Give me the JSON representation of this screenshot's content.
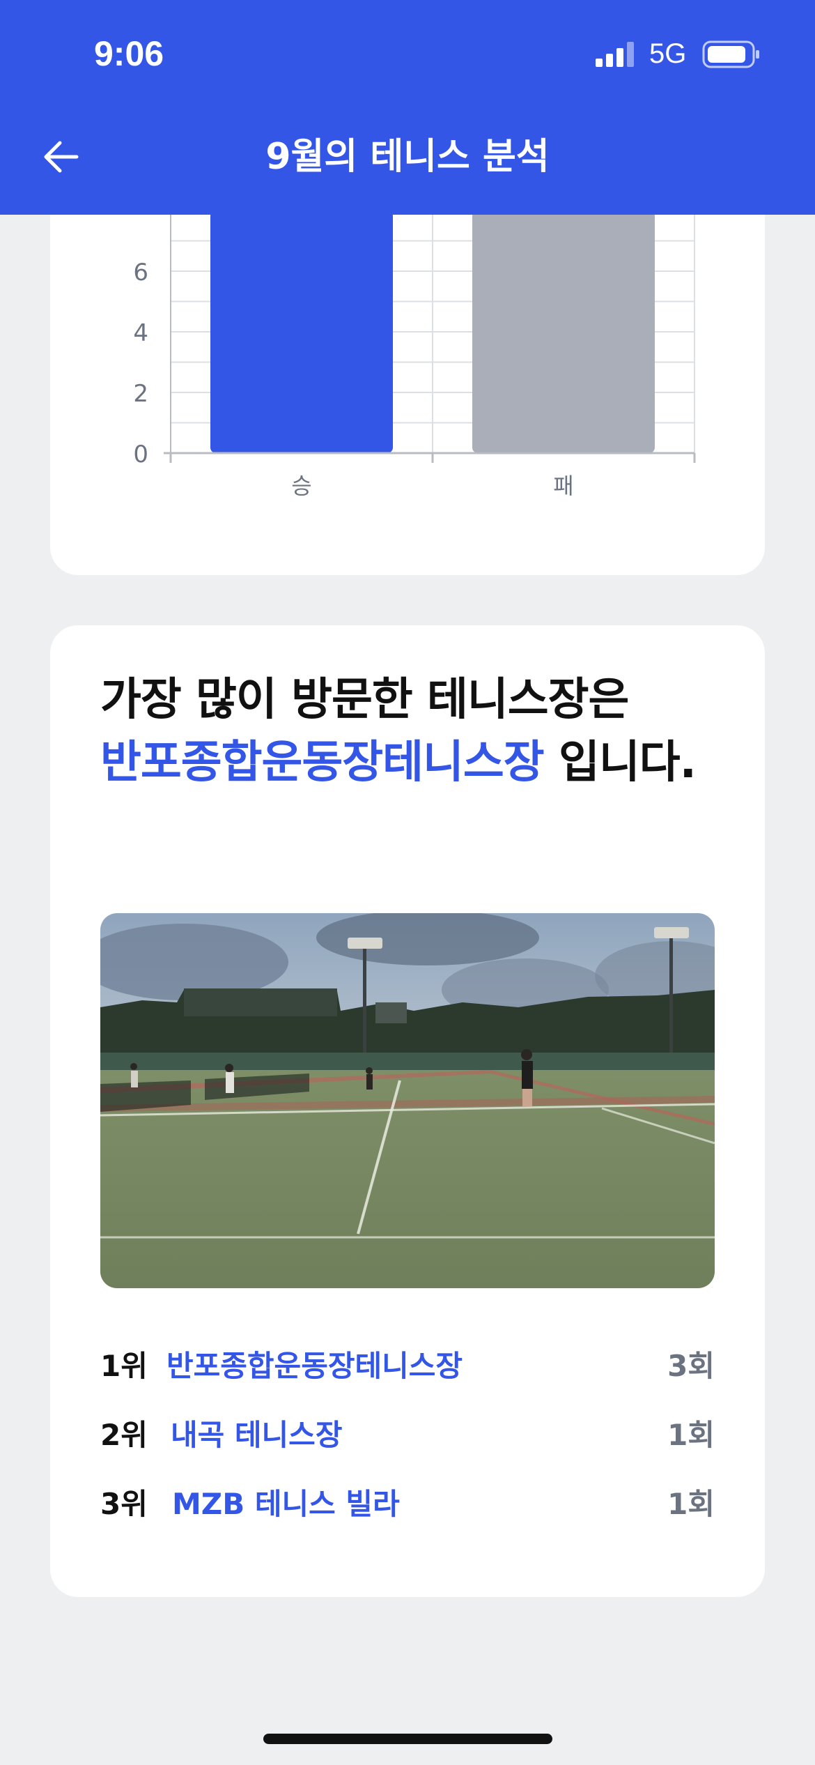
{
  "status_bar": {
    "time": "9:06",
    "network": "5G"
  },
  "header": {
    "title": "9월의 테니스 분석",
    "back_icon": "arrow-left-icon"
  },
  "colors": {
    "brand": "#3356e6",
    "win_bar": "#3356e6",
    "loss_bar": "#a9aeb8",
    "muted_text": "#6b7280"
  },
  "chart_data": {
    "type": "bar",
    "categories": [
      "승",
      "패"
    ],
    "series": [
      {
        "values": [
          8,
          8
        ]
      }
    ],
    "y_ticks": [
      0,
      2,
      4,
      6
    ],
    "ylim": [
      0,
      8
    ],
    "colors": [
      "#3356e6",
      "#a9aeb8"
    ],
    "grid": true,
    "note": ""
  },
  "venue": {
    "headline_prefix": "가장 많이 방문한 테니스장은",
    "headline_venue": "반포종합운동장테니스장",
    "headline_suffix": " 입니다.",
    "photo_alt": "테니스장 사진",
    "rankings": [
      {
        "rank": "1위",
        "name": "반포종합운동장테니스장",
        "count": "3회"
      },
      {
        "rank": "2위",
        "name": "내곡 테니스장",
        "count": "1회"
      },
      {
        "rank": "3위",
        "name": "MZB 테니스 빌라",
        "count": "1회"
      }
    ]
  }
}
